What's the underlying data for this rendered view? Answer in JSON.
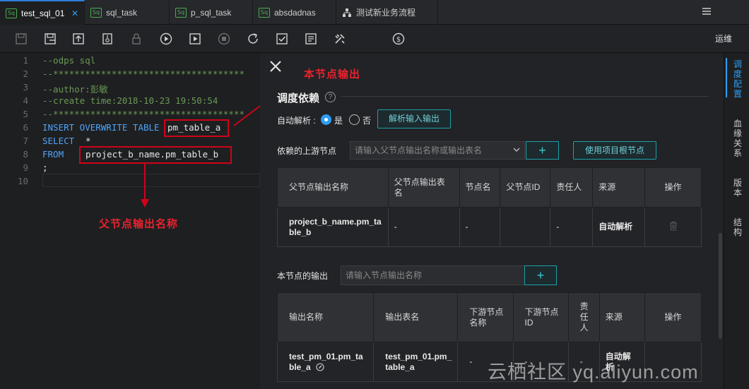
{
  "tabs": [
    {
      "label": "test_sql_01",
      "icon": "sql-icon",
      "badge": "Sq",
      "active": true,
      "close": "✕"
    },
    {
      "label": "sql_task",
      "icon": "sql-icon",
      "badge": "Sq"
    },
    {
      "label": "p_sql_task",
      "icon": "sql-icon",
      "badge": "Sq"
    },
    {
      "label": "absdadnas",
      "icon": "sql-icon",
      "badge": "Sq"
    },
    {
      "label": "测试新业务流程",
      "icon": "workflow-icon"
    }
  ],
  "toolbar": {
    "icons": [
      "save-icon",
      "save-as-icon",
      "submit-icon",
      "steal-lock-icon",
      "lock-icon",
      "run-icon",
      "run-with-params-icon",
      "stop-icon",
      "reload-icon",
      "check-icon",
      "format-icon",
      "tools-icon",
      "cost-icon"
    ],
    "ops_label": "运维"
  },
  "editor": {
    "lines": [
      {
        "no": "1",
        "text": "--odps sql"
      },
      {
        "no": "2",
        "text": "--************************************"
      },
      {
        "no": "3",
        "text": "--author:彭敏"
      },
      {
        "no": "4",
        "text": "--create time:2018-10-23 19:50:54"
      },
      {
        "no": "5",
        "text": "--************************************"
      },
      {
        "no": "6",
        "kw": "INSERT OVERWRITE TABLE",
        "text": "pm_table_a"
      },
      {
        "no": "7",
        "kw": "SELECT",
        "text": "*"
      },
      {
        "no": "8",
        "kw": "FROM",
        "text": "project_b_name.pm_table_b"
      },
      {
        "no": "9",
        "text": ";"
      },
      {
        "no": "10",
        "text": ""
      }
    ]
  },
  "annotations": {
    "node_output": "本节点输出",
    "parent_output": "父节点输出名称"
  },
  "panel": {
    "title": "调度依赖",
    "auto_parse_label": "自动解析 :",
    "yes": "是",
    "no": "否",
    "parse_button": "解析输入输出",
    "upstream_label": "依赖的上游节点",
    "upstream_placeholder": "请输入父节点输出名称或输出表名",
    "use_root_button": "使用项目根节点",
    "plus": "+",
    "upstream_headers": [
      "父节点输出名称",
      "父节点输出表名",
      "节点名",
      "父节点ID",
      "责任人",
      "来源",
      "操作"
    ],
    "upstream_rows": [
      {
        "output_name": "project_b_name.pm_table_b",
        "table": "-",
        "node": "-",
        "id": "",
        "owner": "-",
        "source": "自动解析"
      }
    ],
    "output_label": "本节点的输出",
    "output_placeholder": "请输入节点输出名称",
    "output_headers": [
      "输出名称",
      "输出表名",
      "下游节点名称",
      "下游节点ID",
      "责任人",
      "来源",
      "操作"
    ],
    "output_rows": [
      {
        "output_name": "test_pm_01.pm_table_a",
        "table": "test_pm_01.pm_table_a",
        "node": "-",
        "id": "-",
        "owner": "-",
        "source": "自动解析"
      }
    ]
  },
  "sidebar": {
    "items": [
      "调度配置",
      "血缘关系",
      "版本",
      "结构"
    ]
  },
  "watermark": "云栖社区 yq.aliyun.com"
}
